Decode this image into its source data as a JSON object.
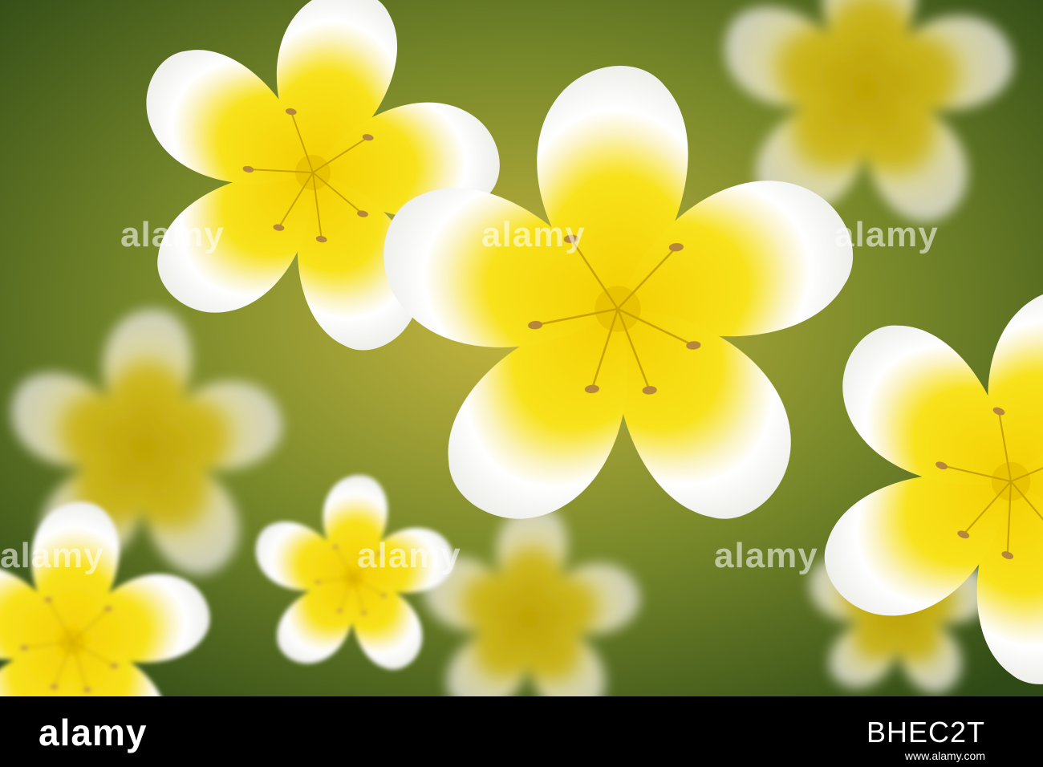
{
  "image": {
    "subject": "flowers",
    "colors": {
      "petal_white": "#f7f7f2",
      "petal_yellow": "#f2d40f",
      "center_yellow": "#e8c400",
      "foliage": "#3c5a1a",
      "stamen": "#b8883a"
    }
  },
  "watermarks": [
    "alamy",
    "alamy",
    "alamy",
    "alamy",
    "alamy",
    "alamy"
  ],
  "footer": {
    "logo": "alamy",
    "image_id": "BHEC2T",
    "url": "www.alamy.com"
  }
}
